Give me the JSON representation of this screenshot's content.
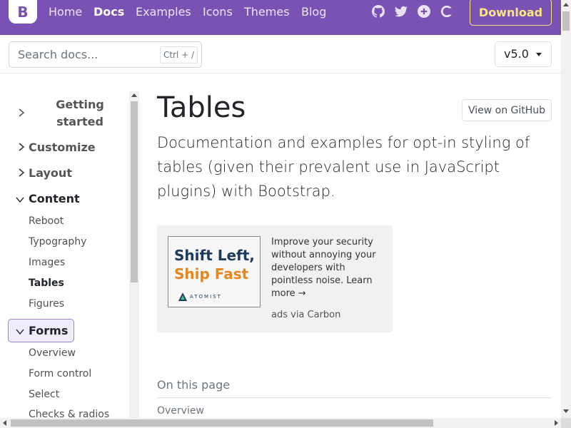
{
  "navbar": {
    "brand_letter": "B",
    "links": [
      "Home",
      "Docs",
      "Examples",
      "Icons",
      "Themes",
      "Blog"
    ],
    "icons": [
      "github-icon",
      "twitter-icon",
      "slack-icon",
      "opencollective-icon"
    ],
    "download_label": "Download",
    "colors": {
      "background": "#7952b3",
      "download": "#ffe484"
    }
  },
  "search": {
    "placeholder": "Search docs...",
    "shortcut": "Ctrl + /"
  },
  "version": {
    "label": "v5.0"
  },
  "sidebar": {
    "groups": [
      {
        "label": "Getting started",
        "expanded": false
      },
      {
        "label": "Customize",
        "expanded": false
      },
      {
        "label": "Layout",
        "expanded": false
      },
      {
        "label": "Content",
        "expanded": true,
        "items": [
          "Reboot",
          "Typography",
          "Images",
          "Tables",
          "Figures"
        ],
        "active": "Tables"
      },
      {
        "label": "Forms",
        "expanded": true,
        "items": [
          "Overview",
          "Form control",
          "Select",
          "Checks & radios"
        ]
      }
    ]
  },
  "main": {
    "title": "Tables",
    "github_button": "View on GitHub",
    "lead": "Documentation and examples for opt-in styling of tables (given their prevalent use in JavaScript plugins) with Bootstrap."
  },
  "ad": {
    "image_line1": "Shift Left,",
    "image_line2": "Ship Fast",
    "brand": "ATOMIST",
    "text": "Improve your security without annoying your developers with pointless noise. Learn more →",
    "via": "ads via Carbon"
  },
  "toc": {
    "title": "On this page",
    "items": [
      "Overview"
    ]
  }
}
